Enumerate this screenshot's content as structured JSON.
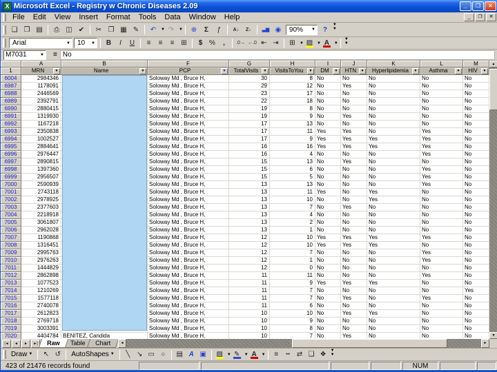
{
  "window": {
    "title": "Microsoft Excel - Registry w Chronic Diseases 2.09"
  },
  "menu_bar": {
    "items": [
      "File",
      "Edit",
      "View",
      "Insert",
      "Format",
      "Tools",
      "Data",
      "Window",
      "Help"
    ]
  },
  "standard_toolbar": {
    "buttons": [
      "new",
      "open",
      "save",
      "print",
      "print-preview",
      "spelling",
      "cut",
      "copy",
      "paste",
      "format-painter",
      "undo",
      "redo",
      "hyperlink",
      "autosum",
      "paste-function",
      "sort-ascending",
      "sort-descending",
      "chart-wizard",
      "map"
    ],
    "zoom_value": "90%",
    "help_label": "?"
  },
  "formatting_toolbar": {
    "font_name": "Arial",
    "font_size": "10",
    "buttons": [
      "bold",
      "italic",
      "underline",
      "align-left",
      "align-center",
      "align-right",
      "merge-and-center",
      "currency",
      "percent",
      "comma",
      "increase-decimal",
      "decrease-decimal",
      "decrease-indent",
      "increase-indent",
      "borders",
      "fill-color",
      "font-color"
    ]
  },
  "formula_bar": {
    "name_box": "M7031",
    "equals": "=",
    "value": "No"
  },
  "sheet": {
    "row1_label": "1",
    "pcp_value": "Soloway Md , Bruce H,",
    "masked_column": "Name",
    "active_filter_column": "PCP",
    "columns": [
      {
        "letter": "A",
        "label": "MRN"
      },
      {
        "letter": "B",
        "label": "Name"
      },
      {
        "letter": "F",
        "label": "PCP"
      },
      {
        "letter": "G",
        "label": "TotalVisits"
      },
      {
        "letter": "H",
        "label": "VisitsToYou"
      },
      {
        "letter": "I",
        "label": "DM"
      },
      {
        "letter": "J",
        "label": "HTN"
      },
      {
        "letter": "K",
        "label": "Hyperlipidemia"
      },
      {
        "letter": "L",
        "label": "Asthma"
      },
      {
        "letter": "M",
        "label": "HIV"
      }
    ],
    "row_fields": [
      "row_number",
      "mrn",
      "total_visits",
      "visits_to_you",
      "dm",
      "htn",
      "hyperlipidemia",
      "asthma",
      "hiv"
    ],
    "rows": [
      [
        "6004",
        "2984346",
        "30",
        "8",
        "No",
        "No",
        "No",
        "No",
        "No"
      ],
      [
        "6987",
        "1178091",
        "29",
        "12",
        "No",
        "Yes",
        "No",
        "No",
        "No"
      ],
      [
        "6988",
        "2446569",
        "23",
        "17",
        "No",
        "No",
        "No",
        "No",
        "No"
      ],
      [
        "6989",
        "2392791",
        "22",
        "18",
        "No",
        "No",
        "No",
        "No",
        "No"
      ],
      [
        "6990",
        "2880415",
        "19",
        "8",
        "No",
        "No",
        "No",
        "No",
        "No"
      ],
      [
        "6991",
        "1319930",
        "19",
        "9",
        "No",
        "Yes",
        "No",
        "No",
        "No"
      ],
      [
        "6992",
        "1167218",
        "17",
        "13",
        "No",
        "No",
        "No",
        "No",
        "No"
      ],
      [
        "6993",
        "2350838",
        "17",
        "11",
        "Yes",
        "Yes",
        "No",
        "Yes",
        "No"
      ],
      [
        "6994",
        "1002527",
        "17",
        "9",
        "Yes",
        "Yes",
        "Yes",
        "Yes",
        "No"
      ],
      [
        "6995",
        "2884641",
        "16",
        "16",
        "Yes",
        "Yes",
        "Yes",
        "Yes",
        "No"
      ],
      [
        "6996",
        "2976447",
        "16",
        "4",
        "No",
        "No",
        "No",
        "Yes",
        "No"
      ],
      [
        "6997",
        "2890815",
        "15",
        "13",
        "No",
        "Yes",
        "No",
        "No",
        "No"
      ],
      [
        "6998",
        "1397360",
        "15",
        "6",
        "No",
        "No",
        "No",
        "Yes",
        "No"
      ],
      [
        "6999",
        "2956507",
        "15",
        "5",
        "No",
        "No",
        "No",
        "Yes",
        "No"
      ],
      [
        "7000",
        "2590939",
        "13",
        "13",
        "No",
        "No",
        "No",
        "Yes",
        "No"
      ],
      [
        "7001",
        "2743118",
        "13",
        "11",
        "Yes",
        "No",
        "Yes",
        "No",
        "No"
      ],
      [
        "7002",
        "2978925",
        "13",
        "10",
        "No",
        "No",
        "Yes",
        "No",
        "No"
      ],
      [
        "7003",
        "2377603",
        "13",
        "7",
        "No",
        "Yes",
        "No",
        "No",
        "No"
      ],
      [
        "7004",
        "2218918",
        "13",
        "4",
        "No",
        "No",
        "No",
        "No",
        "No"
      ],
      [
        "7005",
        "3061807",
        "13",
        "2",
        "No",
        "No",
        "No",
        "No",
        "No"
      ],
      [
        "7006",
        "2962028",
        "13",
        "1",
        "No",
        "No",
        "No",
        "No",
        "No"
      ],
      [
        "7007",
        "1190868",
        "12",
        "10",
        "Yes",
        "Yes",
        "Yes",
        "Yes",
        "No"
      ],
      [
        "7008",
        "1316451",
        "12",
        "10",
        "Yes",
        "Yes",
        "Yes",
        "No",
        "No"
      ],
      [
        "7009",
        "2995763",
        "12",
        "7",
        "No",
        "No",
        "No",
        "Yes",
        "No"
      ],
      [
        "7010",
        "2976263",
        "12",
        "1",
        "No",
        "No",
        "No",
        "Yes",
        "No"
      ],
      [
        "7011",
        "1444829",
        "12",
        "0",
        "No",
        "No",
        "No",
        "No",
        "No"
      ],
      [
        "7012",
        "2862898",
        "11",
        "11",
        "No",
        "No",
        "No",
        "Yes",
        "No"
      ],
      [
        "7013",
        "1077523",
        "11",
        "9",
        "Yes",
        "Yes",
        "Yes",
        "No",
        "No"
      ],
      [
        "7014",
        "1210269",
        "11",
        "7",
        "No",
        "No",
        "No",
        "No",
        "Yes"
      ],
      [
        "7015",
        "1577118",
        "11",
        "7",
        "No",
        "Yes",
        "No",
        "Yes",
        "No"
      ],
      [
        "7016",
        "2740078",
        "11",
        "6",
        "No",
        "No",
        "No",
        "No",
        "No"
      ],
      [
        "7017",
        "2612823",
        "10",
        "10",
        "No",
        "Yes",
        "Yes",
        "No",
        "No"
      ],
      [
        "7018",
        "2769718",
        "10",
        "9",
        "No",
        "No",
        "No",
        "No",
        "No"
      ],
      [
        "7019",
        "3003391",
        "10",
        "8",
        "No",
        "No",
        "No",
        "No",
        "No"
      ]
    ],
    "partial_row": {
      "row_number": "7020",
      "mrn": "4404784",
      "name": "BENITEZ, Candida",
      "total_visits": "10",
      "visits_to_you": "7",
      "dm": "No",
      "htn": "Yes",
      "hyperlipidemia": "No",
      "asthma": "No",
      "hiv": "No"
    }
  },
  "sheet_tabs": {
    "items": [
      "Raw",
      "Table",
      "Chart"
    ],
    "active": "Raw"
  },
  "drawing_toolbar": {
    "draw_label": "Draw",
    "autoshapes_label": "AutoShapes",
    "buttons": [
      "select-pointer",
      "free-rotate",
      "line",
      "arrow",
      "rectangle",
      "oval",
      "text-box",
      "word-art",
      "clip-art",
      "fill-color",
      "line-color",
      "font-color",
      "line-style",
      "dash-style",
      "arrow-style",
      "shadow",
      "three-d"
    ]
  },
  "status_bar": {
    "message": "423 of 21476 records found",
    "num_lock": "NUM"
  },
  "colors": {
    "title_blue": "#0B50D4",
    "name_mask_blue": "#AFD7F4",
    "filtered_row_number_blue": "#2222BB",
    "active_filter_arrow_blue": "#0000EE",
    "chrome_gray": "#D4D0C8"
  }
}
